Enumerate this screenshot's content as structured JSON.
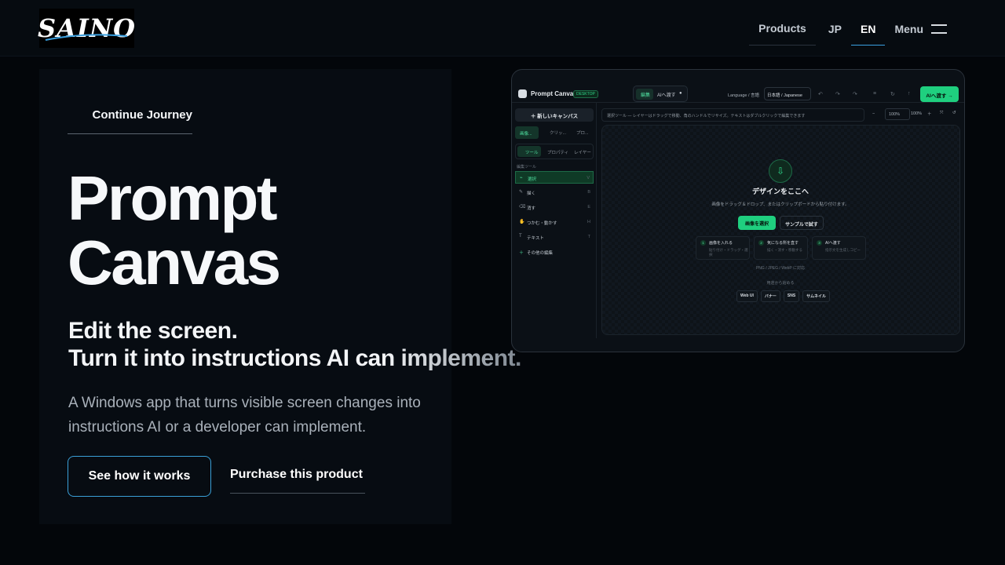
{
  "header": {
    "logo_text": "SAINO",
    "nav": {
      "products": "Products",
      "jp": "JP",
      "en": "EN",
      "menu": "Menu"
    }
  },
  "hero": {
    "continue_label": "Continue Journey",
    "title_line1": "Prompt",
    "title_line2": "Canvas",
    "subtitle_line1": "Edit the screen.",
    "subtitle_line2": "Turn it into instructions AI can implement.",
    "description": "A Windows app that turns visible screen changes into instructions AI or a developer can implement.",
    "primary_button": "See how it works",
    "secondary_button": "Purchase this product"
  },
  "mockup": {
    "app_name": "Prompt Canvas",
    "badge": "DESKTOP",
    "seg_edit": "編集",
    "seg_ai": "AIへ渡す",
    "language_label": "Language / 言語",
    "language_value": "日本語 / Japanese",
    "ai_button": "AIへ渡す →",
    "new_canvas": "新しいキャンバス",
    "tabs1": [
      "画像...",
      "クリッ...",
      "プロ..."
    ],
    "tabs2": [
      "ツール",
      "プロパティ",
      "レイヤー"
    ],
    "section_label": "編集ツール",
    "tools": [
      {
        "label": "選択",
        "key": "V"
      },
      {
        "label": "描く",
        "key": "B"
      },
      {
        "label": "消す",
        "key": "E"
      },
      {
        "label": "つかむ・動かす",
        "key": "H"
      },
      {
        "label": "テキスト",
        "key": "T"
      },
      {
        "label": "その他の編集",
        "key": ""
      }
    ],
    "hint": "選択ツール ― レイヤーはドラッグで移動、角のハンドルでリサイズ。テキストはダブルクリックで編集できます",
    "zoom_a": "100%",
    "zoom_b": "100%",
    "drop_title": "デザインをここへ",
    "drop_sub": "画像をドラッグ＆ドロップ、またはクリップボードから貼り付けます。",
    "choose_button": "画像を選択",
    "sample_button": "サンプルで試す",
    "steps": [
      {
        "n": "1",
        "title": "画像を入れる",
        "sub": "貼り付け・ドラッグ・選択"
      },
      {
        "n": "2",
        "title": "気になる所を直す",
        "sub": "描く・消す・移動する"
      },
      {
        "n": "3",
        "title": "AIへ渡す",
        "sub": "指示文を生成しコピー"
      }
    ],
    "formats": "PNG / JPEG / WebP に対応",
    "start_from": "用途から始める",
    "chips": [
      "Web UI",
      "バナー",
      "SNS",
      "サムネイル"
    ]
  },
  "colors": {
    "accent": "#1fcf7f",
    "link_underline": "#3aa0e0",
    "background": "#03060a"
  }
}
